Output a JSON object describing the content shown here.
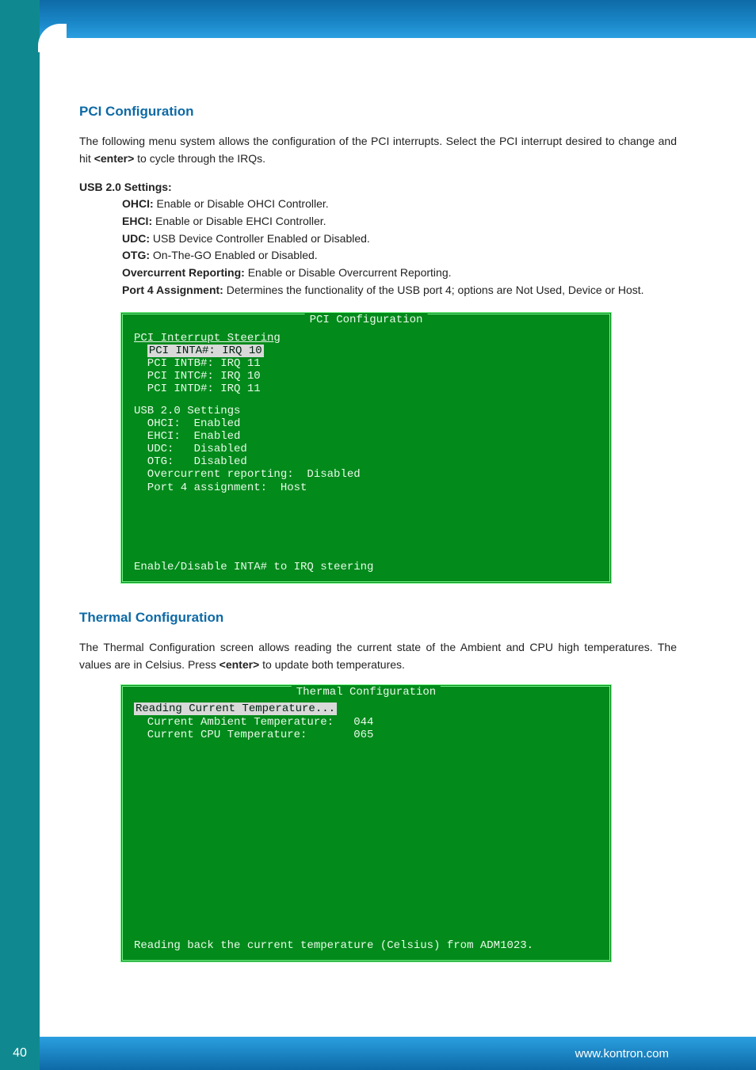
{
  "footer": {
    "pagenum": "40",
    "url": "www.kontron.com"
  },
  "sec1": {
    "heading": "PCI Configuration",
    "para1_a": "The following menu system allows the configuration of the PCI interrupts. Select the PCI interrupt desired to change and hit ",
    "para1_b": "<enter>",
    "para1_c": " to cycle through the IRQs.",
    "usb_hdr": "USB 2.0 Settings:",
    "defs": [
      {
        "k": "OHCI:",
        "v": " Enable or Disable OHCI Controller."
      },
      {
        "k": "EHCI:",
        "v": " Enable or Disable EHCI Controller."
      },
      {
        "k": "UDC:",
        "v": " USB Device Controller Enabled or Disabled."
      },
      {
        "k": "OTG:",
        "v": " On-The-GO Enabled or Disabled."
      },
      {
        "k": "Overcurrent Reporting:",
        "v": " Enable or Disable Overcurrent Reporting."
      },
      {
        "k": "Port 4 Assignment:",
        "v": " Determines the functionality of the USB port 4; options are Not Used, Device or Host."
      }
    ]
  },
  "bios1": {
    "title": " PCI Configuration ",
    "steering_hdr": "PCI Interrupt Steering",
    "sel": "PCI INTA#: IRQ 10",
    "rows": [
      "  PCI INTB#: IRQ 11",
      "  PCI INTC#: IRQ 10",
      "  PCI INTD#: IRQ 11"
    ],
    "usb_hdr": "USB 2.0 Settings",
    "usb_rows": [
      "  OHCI:  Enabled",
      "  EHCI:  Enabled",
      "  UDC:   Disabled",
      "  OTG:   Disabled",
      "  Overcurrent reporting:  Disabled",
      "  Port 4 assignment:  Host"
    ],
    "footer": "Enable/Disable INTA# to IRQ steering"
  },
  "sec2": {
    "heading": "Thermal Configuration",
    "para_a": "The Thermal Configuration screen allows reading the current state of the Ambient and CPU high temperatures. The values are in Celsius. Press ",
    "para_b": "<enter>",
    "para_c": " to update both temperatures."
  },
  "bios2": {
    "title": " Thermal Configuration ",
    "sel": "Reading Current Temperature...",
    "rows": [
      "  Current Ambient Temperature:   044",
      "  Current CPU Temperature:       065"
    ],
    "footer": "Reading back the current temperature (Celsius) from ADM1023."
  },
  "chart_data": [
    {
      "type": "table",
      "title": "PCI Configuration",
      "pci_interrupt_steering": {
        "PCI INTA#": "IRQ 10",
        "PCI INTB#": "IRQ 11",
        "PCI INTC#": "IRQ 10",
        "PCI INTD#": "IRQ 11"
      },
      "usb_2_0_settings": {
        "OHCI": "Enabled",
        "EHCI": "Enabled",
        "UDC": "Disabled",
        "OTG": "Disabled",
        "Overcurrent reporting": "Disabled",
        "Port 4 assignment": "Host"
      },
      "help": "Enable/Disable INTA# to IRQ steering"
    },
    {
      "type": "table",
      "title": "Thermal Configuration",
      "readings_celsius": {
        "Current Ambient Temperature": 44,
        "Current CPU Temperature": 65
      },
      "help": "Reading back the current temperature (Celsius) from ADM1023."
    }
  ]
}
